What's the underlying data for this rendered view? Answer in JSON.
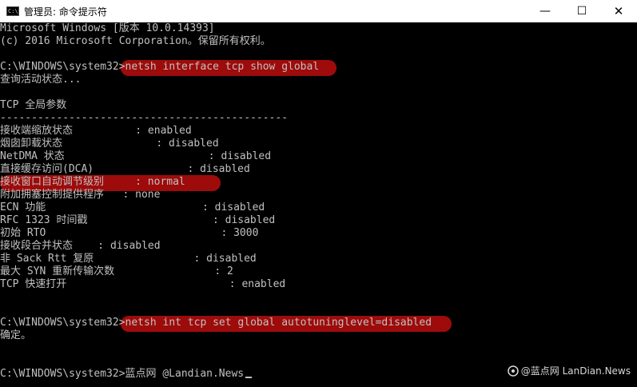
{
  "window": {
    "title": "管理员: 命令提示符",
    "app_icon_text": "C:\\",
    "minimize": "—",
    "maximize": "☐",
    "close": "✕"
  },
  "console": {
    "lines": [
      "Microsoft Windows [版本 10.0.14393]",
      "(c) 2016 Microsoft Corporation。保留所有权利。",
      "",
      "C:\\WINDOWS\\system32>netsh interface tcp show global",
      "查询活动状态...",
      "",
      "TCP 全局参数",
      "----------------------------------------------",
      "接收端缩放状态          : enabled",
      "烟囱卸载状态               : disabled",
      "NetDMA 状态                       : disabled",
      "直接缓存访问(DCA)               : disabled",
      "接收窗口自动调节级别     : normal",
      "附加拥塞控制提供程序   : none",
      "ECN 功能                         : disabled",
      "RFC 1323 时间戳                    : disabled",
      "初始 RTO                            : 3000",
      "接收段合并状态    : disabled",
      "非 Sack Rtt 复原                : disabled",
      "最大 SYN 重新传输次数                : 2",
      "TCP 快速打开                          : enabled",
      "",
      "",
      "C:\\WINDOWS\\system32>netsh int tcp set global autotuninglevel=disabled",
      "确定。",
      "",
      "",
      "C:\\WINDOWS\\system32>蓝点网 @Landian.News"
    ]
  },
  "watermark": {
    "text": "@蓝点网 LanDian.News"
  },
  "colors": {
    "highlight": "#9e0b0b",
    "console_text": "#c0c0c0"
  }
}
